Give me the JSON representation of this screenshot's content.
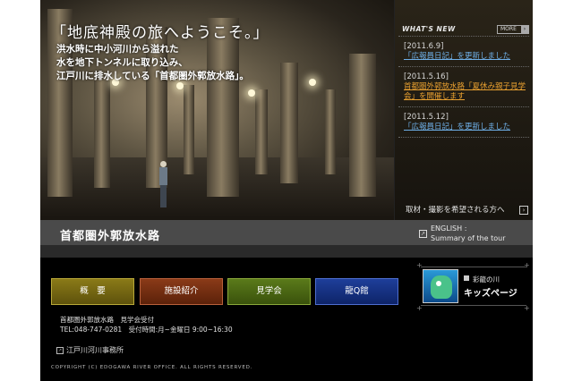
{
  "hero": {
    "title": "「地底神殿の旅へようこそ。」",
    "desc_lines": [
      "洪水時に中小河川から溢れた",
      "水を地下トンネルに取り込み、",
      "江戸川に排水している「首都圏外郭放水路」。"
    ]
  },
  "news": {
    "title": "WHAT'S NEW",
    "more_label": "MORE",
    "items": [
      {
        "date": "[2011.6.9]",
        "text": "「広報員日記」を更新しました",
        "accent": "blue"
      },
      {
        "date": "[2011.5.16]",
        "text": "首都圏外郭放水路「夏休み親子見学会」を開催します",
        "accent": "orange"
      },
      {
        "date": "[2011.5.12]",
        "text": "「広報員日記」を更新しました",
        "accent": "blue"
      }
    ],
    "interview_label": "取材・撮影を希望される方へ"
  },
  "titlebar": {
    "site_name": "首都圏外郭放水路",
    "english_line1": "ENGLISH :",
    "english_line2": "Summary of the tour"
  },
  "nav": [
    {
      "label": "概　要"
    },
    {
      "label": "施設紹介"
    },
    {
      "label": "見学会"
    },
    {
      "label": "龍Q館"
    }
  ],
  "kids": {
    "subtitle": "彩龍の川",
    "title": "キッズページ"
  },
  "info": {
    "line1": "首都圏外郭放水路　見学会受付",
    "line2": "TEL:048-747-0281　受付時間:月~金曜日 9:00~16:30"
  },
  "office": "江戸川河川事務所",
  "copyright": "COPYRIGHT (C) EDOGAWA RIVER OFFICE. ALL RIGHTS RESERVED."
}
